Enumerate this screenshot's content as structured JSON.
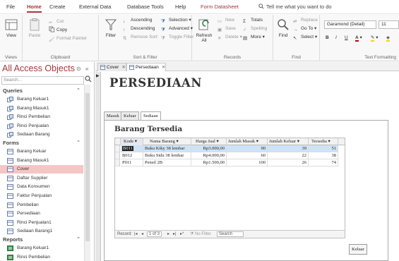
{
  "ribbon_tabs": [
    "File",
    "Home",
    "Create",
    "External Data",
    "Database Tools",
    "Help",
    "Form Datasheet"
  ],
  "tell_me": "Tell me what you want to do",
  "ribbon": {
    "views": {
      "view_label": "View",
      "group": "Views"
    },
    "clipboard": {
      "paste": "Paste",
      "cut": "Cut",
      "copy": "Copy",
      "format_painter": "Format Painter",
      "group": "Clipboard"
    },
    "sort_filter": {
      "filter": "Filter",
      "ascending": "Ascending",
      "descending": "Descending",
      "remove_sort": "Remove Sort",
      "selection": "Selection",
      "advanced": "Advanced",
      "toggle_filter": "Toggle Filter",
      "group": "Sort & Filter"
    },
    "records": {
      "refresh": "Refresh All",
      "new": "New",
      "save": "Save",
      "delete": "Delete",
      "totals": "Totals",
      "spelling": "Spelling",
      "more": "More",
      "group": "Records"
    },
    "find": {
      "find": "Find",
      "replace": "Replace",
      "goto": "Go To",
      "select": "Select",
      "group": "Find"
    },
    "text_formatting": {
      "font": "Garamond (Detail)",
      "size": "11",
      "bold": "B",
      "italic": "I",
      "underline": "U",
      "group": "Text Formatting"
    }
  },
  "nav": {
    "title": "All Access Objects",
    "search_placeholder": "Search...",
    "sections": [
      {
        "name": "Queries",
        "items": [
          "Barang Keluar1",
          "Barang Masuk1",
          "Rinci Pembelian",
          "Rinci Penjualan",
          "Sediaan Barang"
        ]
      },
      {
        "name": "Forms",
        "items": [
          "Barang Keluar",
          "Barang Masuk1",
          "Cover",
          "Daftar Supplier",
          "Data Konsumen",
          "Faktur Penjualan",
          "Pembelian",
          "Persediaan",
          "Rinci Penjualan1",
          "Sediaan Barang1"
        ]
      },
      {
        "name": "Reports",
        "items": [
          "Barang Keluar1",
          "Rinci Pembelian"
        ]
      }
    ],
    "selected_item": "Cover"
  },
  "doc_tabs": [
    "Cover",
    "Persediaan"
  ],
  "form": {
    "title": "PERSEDIAAN",
    "tabs": [
      "Masuk",
      "Keluar",
      "Sediaan"
    ],
    "active_tab": "Sediaan",
    "section_title": "Barang Tersedia",
    "columns": [
      "Kode",
      "Nama Barang",
      "Harga Jual",
      "Jumlah Masuk",
      "Jumlah Keluar",
      "Tersedia"
    ],
    "rows": [
      [
        "B011",
        "Buku Kiky 38 lembar",
        "Rp3.000,00",
        "90",
        "39",
        "51"
      ],
      [
        "B012",
        "Buku Sidu 38 lembar",
        "Rp4.000,00",
        "60",
        "22",
        "38"
      ],
      [
        "P011",
        "Pensil 2B",
        "Rp1.500,00",
        "100",
        "26",
        "74"
      ]
    ],
    "record_nav": {
      "label": "Record:",
      "position": "1 of 3",
      "no_filter": "No Filter",
      "search": "Search"
    },
    "button": "Keluar"
  }
}
